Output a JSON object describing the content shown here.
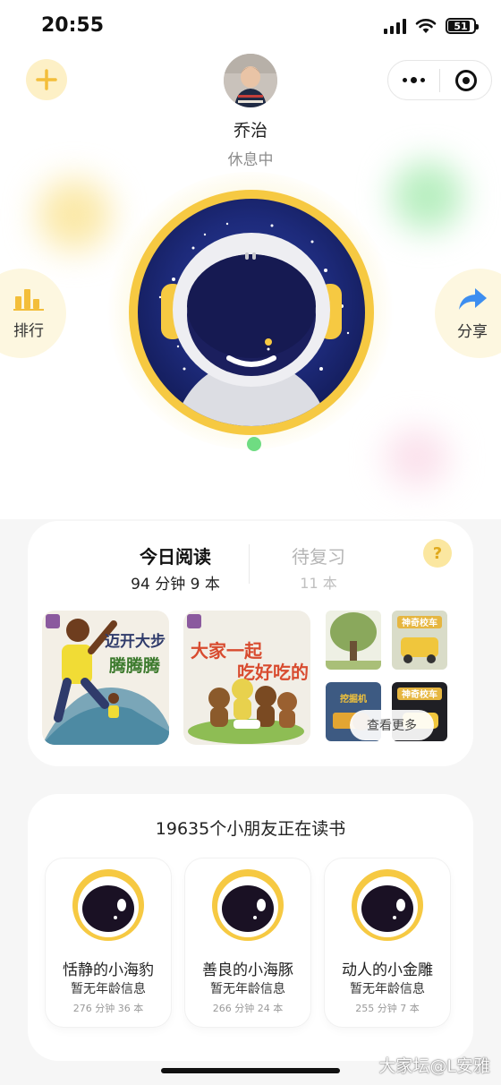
{
  "status_bar": {
    "time": "20:55",
    "battery": "51"
  },
  "header": {
    "child_name": "乔治",
    "child_status": "休息中",
    "add_icon": "plus-icon",
    "more_icon": "more-dots-icon",
    "close_icon": "target-icon"
  },
  "side": {
    "rank_label": "排行",
    "rank_icon": "bar-chart-icon",
    "share_label": "分享",
    "share_icon": "share-arrow-icon"
  },
  "reading": {
    "today_label": "今日阅读",
    "today_stats": "94 分钟 9 本",
    "review_label": "待复习",
    "review_stats": "11 本",
    "help_symbol": "?",
    "more_label": "查看更多",
    "books": [
      {
        "title": "迈开大步 腾腾腾"
      },
      {
        "title": "大家一起吃好吃的"
      }
    ],
    "small_books": [
      {
        "title": ""
      },
      {
        "title": "神奇校车"
      },
      {
        "title": "挖掘机"
      },
      {
        "title": "神奇校车"
      }
    ]
  },
  "friends": {
    "title": "19635个小朋友正在读书",
    "items": [
      {
        "name": "恬静的小海豹",
        "age": "暂无年龄信息",
        "stats": "276 分钟 36 本"
      },
      {
        "name": "善良的小海豚",
        "age": "暂无年龄信息",
        "stats": "266 分钟 24 本"
      },
      {
        "name": "动人的小金雕",
        "age": "暂无年龄信息",
        "stats": "255 分钟 7 本"
      }
    ]
  },
  "watermark": "大家坛@L安雅",
  "colors": {
    "accent_yellow": "#f6c942",
    "online_green": "#6fdc82",
    "share_blue": "#3d8ef0"
  }
}
